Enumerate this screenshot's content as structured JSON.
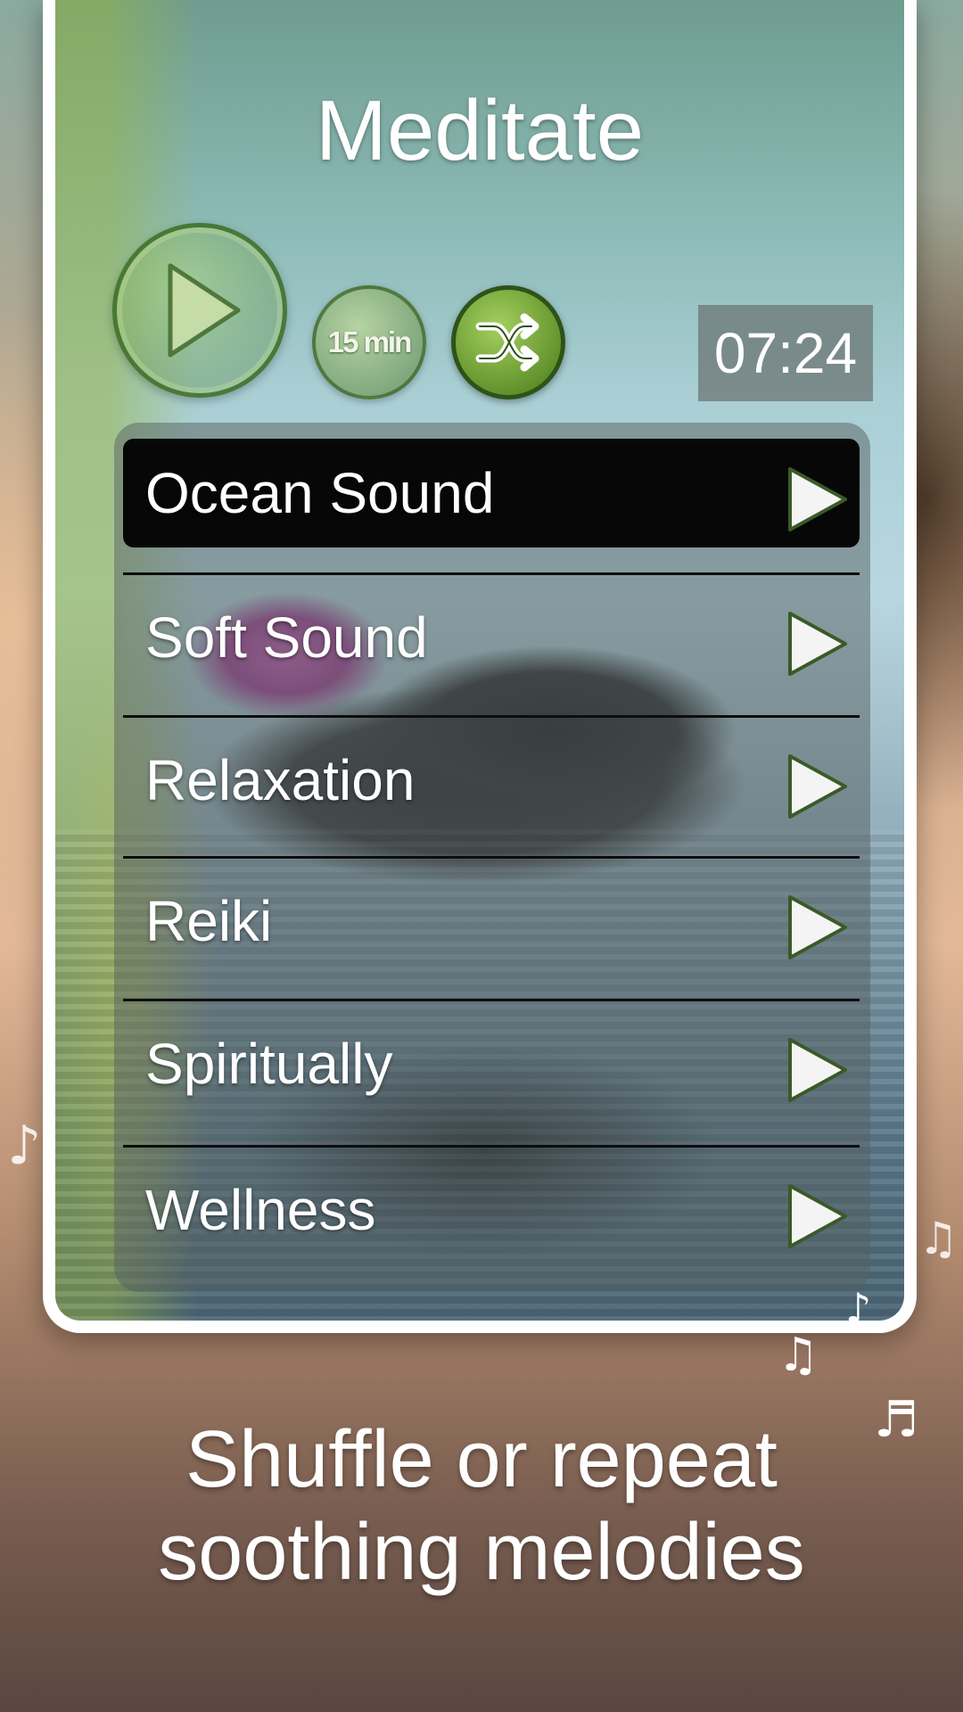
{
  "app": {
    "title": "Meditate"
  },
  "controls": {
    "timer_label": "15 min",
    "elapsed_time": "07:24"
  },
  "tracks": [
    {
      "label": "Ocean Sound",
      "active": true
    },
    {
      "label": "Soft Sound",
      "active": false
    },
    {
      "label": "Relaxation",
      "active": false
    },
    {
      "label": "Reiki",
      "active": false
    },
    {
      "label": "Spiritually",
      "active": false
    },
    {
      "label": "Wellness",
      "active": false
    }
  ],
  "caption": {
    "line1": "Shuffle or repeat",
    "line2": "soothing melodies"
  },
  "colors": {
    "accent_green": "#5f8f2a",
    "active_row": "#070707"
  }
}
